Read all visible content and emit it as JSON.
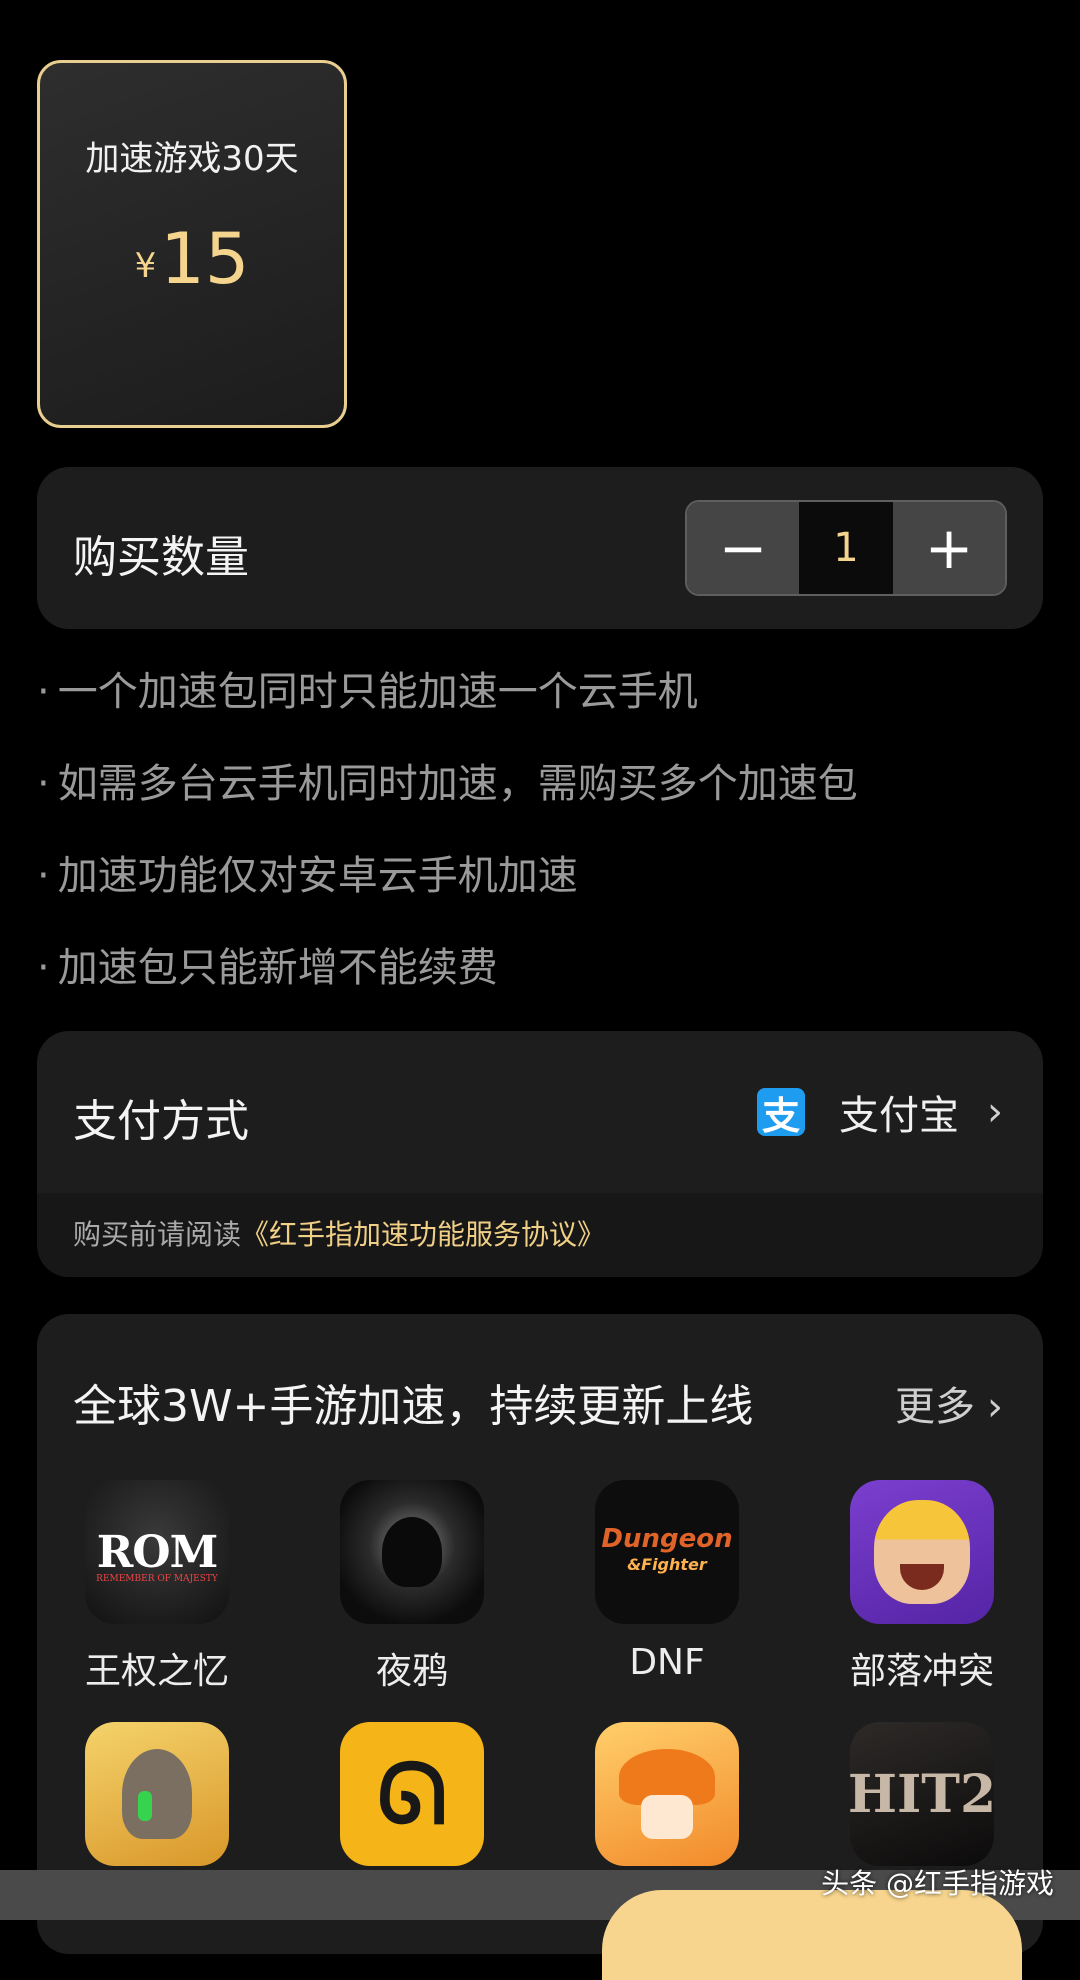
{
  "package": {
    "title": "加速游戏30天",
    "currency": "¥",
    "price": "15"
  },
  "quantity": {
    "label": "购买数量",
    "minus": "−",
    "plus": "+",
    "value": "1"
  },
  "notes": [
    "一个加速包同时只能加速一个云手机",
    "如需多台云手机同时加速，需购买多个加速包",
    "加速功能仅对安卓云手机加速",
    "加速包只能新增不能续费"
  ],
  "note_bullet": "·",
  "payment": {
    "label": "支付方式",
    "icon": "alipay-icon",
    "icon_glyph": "支",
    "method": "支付宝",
    "chevron": "›",
    "agreement_prefix": "购买前请阅读",
    "agreement_link": "《红手指加速功能服务协议》"
  },
  "games": {
    "title": "全球3W+手游加速，持续更新上线",
    "more": "更多",
    "chevron": "›",
    "items": [
      {
        "name": "王权之忆",
        "icon": "rom-icon",
        "glyph": "ROM",
        "sub": "REMEMBER OF MAJESTY"
      },
      {
        "name": "夜鸦",
        "icon": "crow-icon"
      },
      {
        "name": "DNF",
        "icon": "dnf-icon",
        "glyph": "Dungeon",
        "sub": "&Fighter"
      },
      {
        "name": "部落冲突",
        "icon": "clash-of-clans-icon"
      },
      {
        "name": "",
        "icon": "bird-icon"
      },
      {
        "name": "",
        "icon": "dragon-icon",
        "glyph": "ᘏ"
      },
      {
        "name": "",
        "icon": "maple-mushroom-icon"
      },
      {
        "name": "",
        "icon": "hit2-icon",
        "glyph": "HIT2"
      }
    ]
  },
  "watermark": "头条 @红手指游戏",
  "colors": {
    "accent": "#f5d48e",
    "panel": "#1d1d1d",
    "alipay": "#1e9cf0"
  }
}
